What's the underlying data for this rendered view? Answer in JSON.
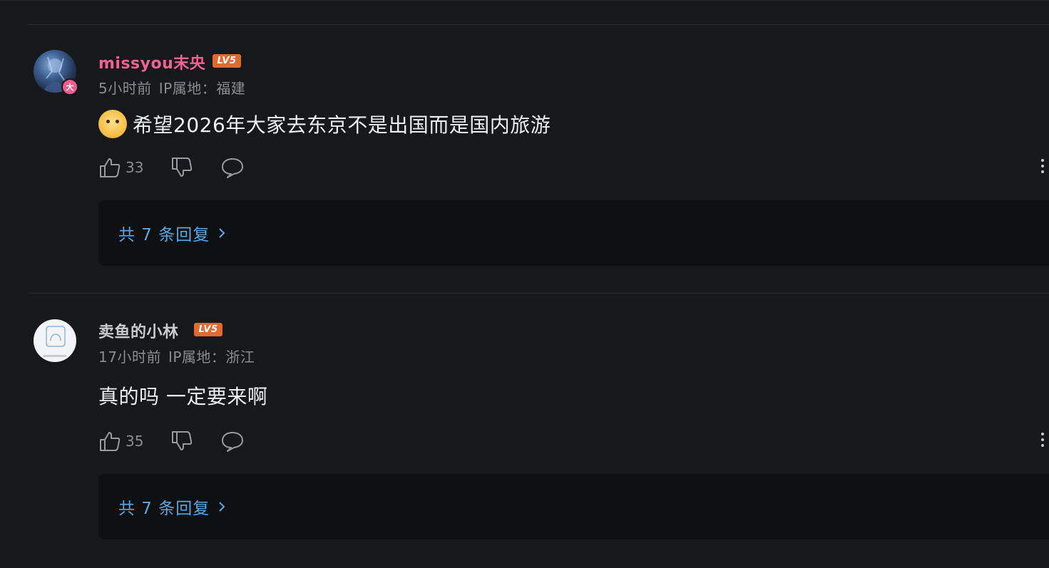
{
  "comments": [
    {
      "username": "missyou末央",
      "level": "LV5",
      "vip_badge": "大",
      "time": "5小时前",
      "ip": "IP属地：福建",
      "text": "希望2026年大家去东京不是出国而是国内旅游",
      "likes": "33",
      "replies": "共 7 条回复"
    },
    {
      "username": "卖鱼的小林",
      "level": "LV5",
      "time": "17小时前",
      "ip": "IP属地：浙江",
      "text": "真的吗 一定要来啊",
      "likes": "35",
      "replies": "共 7 条回复"
    }
  ],
  "colors": {
    "background": "#17181b",
    "username_highlight": "#f0638f",
    "level_badge": "#e36a2f",
    "reply_link": "#5aa7e6"
  },
  "icons": [
    "thumb-up-icon",
    "thumb-down-icon",
    "comment-icon",
    "more-icon",
    "chevron-right-icon",
    "doge-emoji"
  ]
}
